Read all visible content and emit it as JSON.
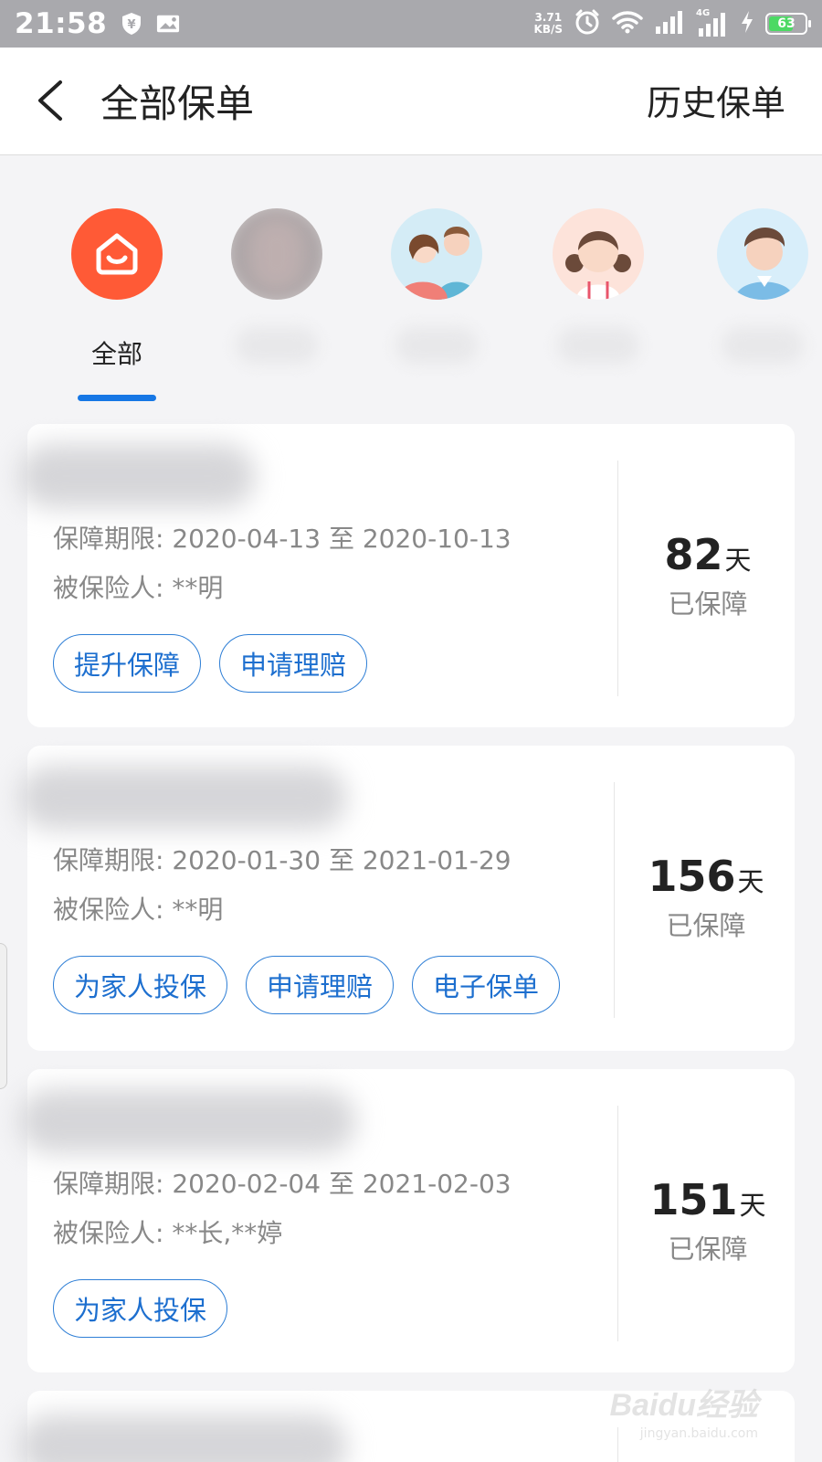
{
  "status_bar": {
    "time": "21:58",
    "net_speed_value": "3.71",
    "net_speed_unit": "KB/S",
    "network_type": "4G",
    "battery_level": "63"
  },
  "header": {
    "title": "全部保单",
    "history_link": "历史保单"
  },
  "tabs": {
    "selected_label": "全部",
    "items": [
      {
        "name": "全部",
        "icon": "home-icon",
        "selected": true
      },
      {
        "name": "",
        "icon": "blurred-photo-avatar"
      },
      {
        "name": "",
        "icon": "couple-avatar"
      },
      {
        "name": "",
        "icon": "girl-avatar"
      },
      {
        "name": "",
        "icon": "man-avatar"
      }
    ]
  },
  "policies": [
    {
      "period": "保障期限: 2020-04-13 至 2020-10-13",
      "insured": "被保险人: **明",
      "days": "82",
      "days_unit": "天",
      "days_label": "已保障",
      "actions": [
        "提升保障",
        "申请理赔"
      ]
    },
    {
      "period": "保障期限: 2020-01-30 至 2021-01-29",
      "insured": "被保险人: **明",
      "days": "156",
      "days_unit": "天",
      "days_label": "已保障",
      "actions": [
        "为家人投保",
        "申请理赔",
        "电子保单"
      ]
    },
    {
      "period": "保障期限: 2020-02-04 至 2021-02-03",
      "insured": "被保险人: **长,**婷",
      "days": "151",
      "days_unit": "天",
      "days_label": "已保障",
      "actions": [
        "为家人投保"
      ]
    }
  ],
  "colors": {
    "accent": "#1677e5",
    "button_text": "#1d6fcf",
    "home_avatar": "#ff5a36"
  },
  "watermark": {
    "logo": "Baidu经验",
    "url": "jingyan.baidu.com"
  }
}
